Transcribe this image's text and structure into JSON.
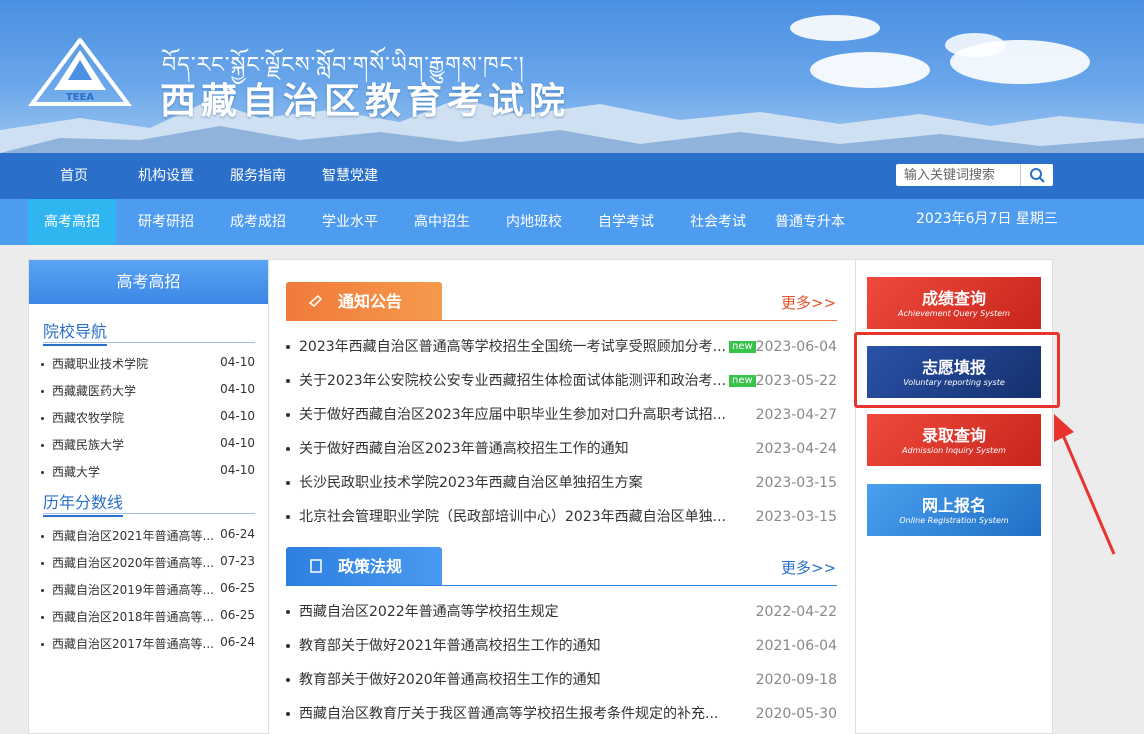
{
  "header": {
    "tibetan": "བོད་རང་སྐྱོང་ལྗོངས་སློབ་གསོ་ཡིག་རྒྱུགས་ཁང་།",
    "title": "西藏自治区教育考试院",
    "logo_text": "TEEA"
  },
  "nav_primary": [
    "首页",
    "机构设置",
    "服务指南",
    "智慧党建"
  ],
  "search": {
    "placeholder": "输入关键词搜索"
  },
  "nav_secondary": [
    "高考高招",
    "研考研招",
    "成考成招",
    "学业水平",
    "高中招生",
    "内地班校",
    "自学考试",
    "社会考试",
    "普通专升本"
  ],
  "date": "2023年6月7日 星期三",
  "left": {
    "title": "高考高招",
    "section1": "院校导航",
    "schools": [
      {
        "name": "西藏职业技术学院",
        "date": "04-10"
      },
      {
        "name": "西藏藏医药大学",
        "date": "04-10"
      },
      {
        "name": "西藏农牧学院",
        "date": "04-10"
      },
      {
        "name": "西藏民族大学",
        "date": "04-10"
      },
      {
        "name": "西藏大学",
        "date": "04-10"
      }
    ],
    "section2": "历年分数线",
    "scores": [
      {
        "name": "西藏自治区2021年普通高等...",
        "date": "06-24"
      },
      {
        "name": "西藏自治区2020年普通高等...",
        "date": "07-23"
      },
      {
        "name": "西藏自治区2019年普通高等...",
        "date": "06-25"
      },
      {
        "name": "西藏自治区2018年普通高等...",
        "date": "06-25"
      },
      {
        "name": "西藏自治区2017年普通高等...",
        "date": "06-24"
      }
    ]
  },
  "notice": {
    "title": "通知公告",
    "more": "更多>>",
    "items": [
      {
        "text": "2023年西藏自治区普通高等学校招生全国统一考试享受照顾加分考...",
        "new": "new",
        "date": "2023-06-04"
      },
      {
        "text": "关于2023年公安院校公安专业西藏招生体检面试体能测评和政治考...",
        "new": "new",
        "date": "2023-05-22"
      },
      {
        "text": "关于做好西藏自治区2023年应届中职毕业生参加对口升高职考试招...",
        "new": "",
        "date": "2023-04-27"
      },
      {
        "text": "关于做好西藏自治区2023年普通高校招生工作的通知",
        "new": "",
        "date": "2023-04-24"
      },
      {
        "text": "长沙民政职业技术学院2023年西藏自治区单独招生方案",
        "new": "",
        "date": "2023-03-15"
      },
      {
        "text": "北京社会管理职业学院（民政部培训中心）2023年西藏自治区单独...",
        "new": "",
        "date": "2023-03-15"
      }
    ]
  },
  "policy": {
    "title": "政策法规",
    "more": "更多>>",
    "items": [
      {
        "text": "西藏自治区2022年普通高等学校招生规定",
        "date": "2022-04-22"
      },
      {
        "text": "教育部关于做好2021年普通高校招生工作的通知",
        "date": "2021-06-04"
      },
      {
        "text": "教育部关于做好2020年普通高校招生工作的通知",
        "date": "2020-09-18"
      },
      {
        "text": "西藏自治区教育厅关于我区普通高等学校招生报考条件规定的补充...",
        "date": "2020-05-30"
      }
    ]
  },
  "quick": [
    {
      "cn": "成绩查询",
      "en": "Achievement Query System",
      "color": "#e03a2e"
    },
    {
      "cn": "志愿填报",
      "en": "Voluntary reporting syste",
      "color": "#1f3f8a"
    },
    {
      "cn": "录取查询",
      "en": "Admission Inquiry System",
      "color": "#e03a2e"
    },
    {
      "cn": "网上报名",
      "en": "Online Registration System",
      "color": "#2f86d6"
    }
  ]
}
